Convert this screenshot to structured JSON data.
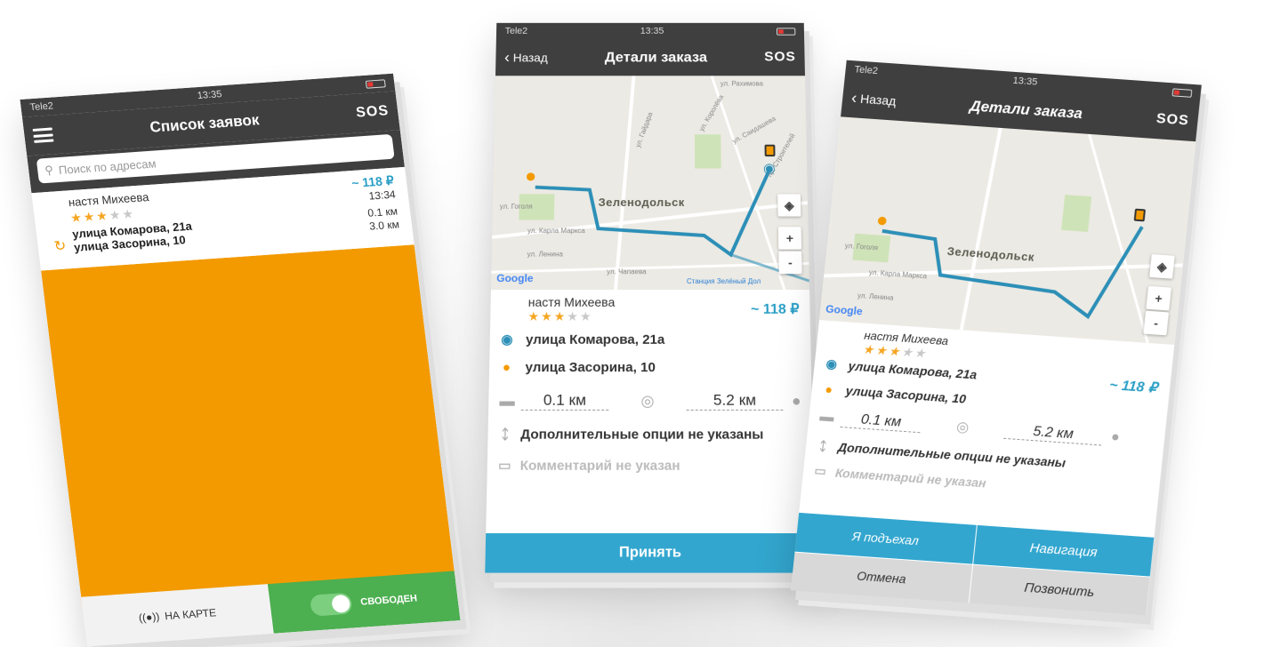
{
  "status": {
    "carrier": "Tele2",
    "time": "13:35"
  },
  "left": {
    "title": "Список заявок",
    "sos": "SOS",
    "search_placeholder": "Поиск по адресам",
    "order": {
      "name": "настя Михеева",
      "price": "~ 118 ₽",
      "time": "13:34",
      "dist1": "0.1 км",
      "dist2": "3.0 км",
      "from": "улица Комарова, 21а",
      "to": "улица Засорина, 10"
    },
    "map_button": "НА КАРТЕ",
    "toggle_label": "СВОБОДЕН"
  },
  "center": {
    "back": "Назад",
    "title": "Детали заказа",
    "sos": "SOS",
    "map": {
      "city": "Зеленодольск",
      "streets": [
        "ул. Гоголя",
        "ул. Карла Маркса",
        "ул. Ленина",
        "ул. Чапаева",
        "ул. Гайдара",
        "ул. Королёва",
        "ул. Саидашева",
        "ул. Рахимова",
        "пр. Строителей"
      ],
      "station": "Станция Зелёный Дол",
      "google": "Google"
    },
    "name": "настя Михеева",
    "price": "~ 118 ₽",
    "from": "улица Комарова, 21а",
    "to": "улица Засорина, 10",
    "dist1": "0.1 км",
    "dist2": "5.2 км",
    "options": "Дополнительные опции не указаны",
    "comment": "Комментарий не указан",
    "accept": "Принять"
  },
  "right": {
    "back": "Назад",
    "title": "Детали заказа",
    "sos": "SOS",
    "name": "настя Михеева",
    "price": "~ 118 ₽",
    "from": "улица Комарова, 21а",
    "to": "улица Засорина, 10",
    "dist1": "0.1 км",
    "dist2": "5.2 км",
    "options": "Дополнительные опции не указаны",
    "comment": "Комментарий не указан",
    "arrived": "Я подъехал",
    "navigation": "Навигация",
    "cancel": "Отмена",
    "call": "Позвонить"
  },
  "colors": {
    "accent_orange": "#f39a00",
    "accent_blue": "#32a6cf",
    "toolbar": "#3f3f3f",
    "green": "#4caf50"
  }
}
